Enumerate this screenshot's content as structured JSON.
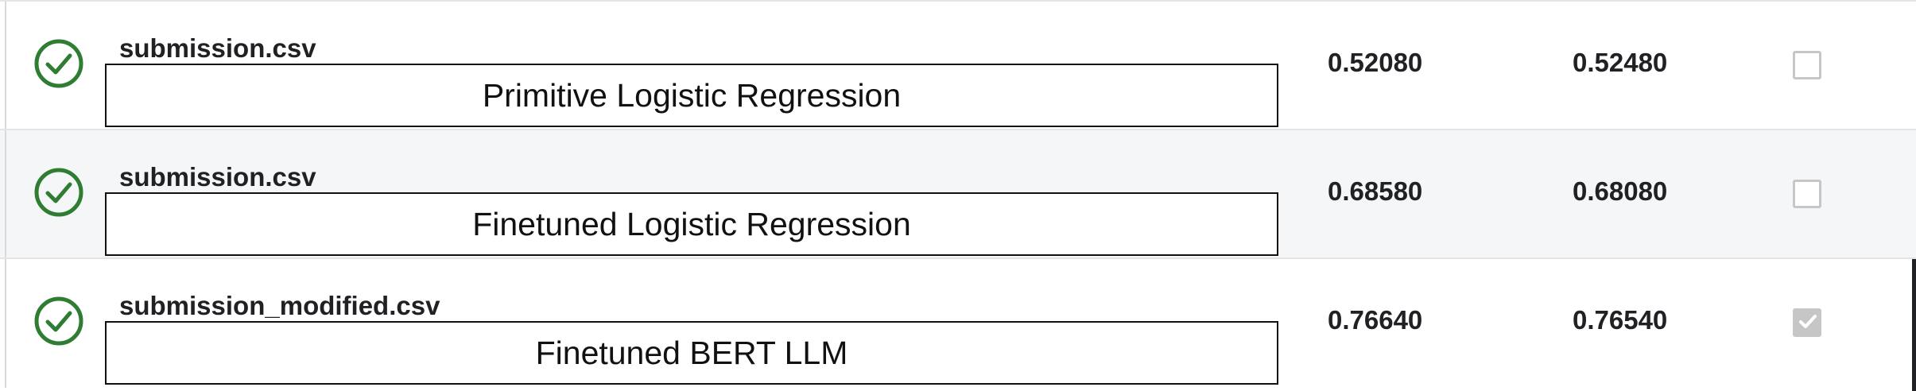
{
  "submissions": [
    {
      "filename": "submission.csv",
      "description": "Primitive Logistic Regression",
      "private_score": "0.52080",
      "public_score": "0.52480",
      "selected": false,
      "status_icon": "check-circle-icon"
    },
    {
      "filename": "submission.csv",
      "description": "Finetuned Logistic Regression",
      "private_score": "0.68580",
      "public_score": "0.68080",
      "selected": false,
      "status_icon": "check-circle-icon"
    },
    {
      "filename": "submission_modified.csv",
      "description": "Finetuned BERT LLM",
      "private_score": "0.76640",
      "public_score": "0.76540",
      "selected": true,
      "status_icon": "check-circle-icon"
    }
  ],
  "colors": {
    "status_success": "#2e7d32",
    "row_alt_bg": "#f5f6f7",
    "checkbox": "#c6c6c6"
  }
}
